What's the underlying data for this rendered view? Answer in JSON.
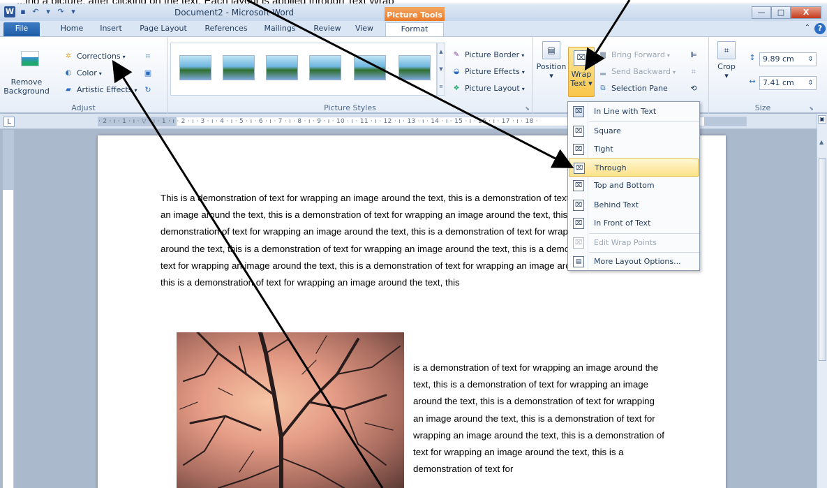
{
  "caption_top": "...ing a picture, after clicking on the text. Each layout is applied through Text Wrap",
  "title_bar": {
    "app_icon_letter": "W",
    "doc_title": "Document2 - Microsoft Word",
    "context_tab": "Picture Tools",
    "minimize": "—",
    "maximize": "□",
    "close": "X"
  },
  "tabs": [
    "File",
    "Home",
    "Insert",
    "Page Layout",
    "References",
    "Mailings",
    "Review",
    "View",
    "Format"
  ],
  "active_tab": "Format",
  "ribbon": {
    "adjust": {
      "remove_background": "Remove Background",
      "corrections": "Corrections",
      "color": "Color",
      "artistic_effects": "Artistic Effects",
      "label": "Adjust"
    },
    "picture_styles": {
      "border": "Picture Border",
      "effects": "Picture Effects",
      "layout": "Picture Layout",
      "label": "Picture Styles"
    },
    "arrange": {
      "position": "Position",
      "wrap_text_line1": "Wrap",
      "wrap_text_line2": "Text",
      "bring_forward": "Bring Forward",
      "send_backward": "Send Backward",
      "selection_pane": "Selection Pane"
    },
    "size": {
      "crop": "Crop",
      "height": "9.89 cm",
      "width": "7.41 cm",
      "label": "Size"
    }
  },
  "ruler_top_text": "· 2 · ı · 1 · ı · ▽ · ı · 1 · ı · 2 · ı · 3 · ı · 4 · ı · 5 · ı · 6 · ı · 7 · ı · 8 · ı · 9 · ı · 10 · ı · 11 · ı · 12 · ı · 13 · ı · 14 · ı · 15 · ı · 16 · ı · 17 · ı · 18 ·",
  "ruler_tab_selector": "L",
  "wrap_menu": {
    "items": [
      {
        "label": "In Line with Text",
        "mnemonic": "I"
      },
      {
        "label": "Square",
        "mnemonic": "S"
      },
      {
        "label": "Tight",
        "mnemonic": "T"
      },
      {
        "label": "Through",
        "mnemonic": "h"
      },
      {
        "label": "Top and Bottom",
        "mnemonic": "o"
      },
      {
        "label": "Behind Text",
        "mnemonic": "d"
      },
      {
        "label": "In Front of Text",
        "mnemonic": "n"
      },
      {
        "label": "Edit Wrap Points",
        "mnemonic": "E"
      },
      {
        "label": "More Layout Options...",
        "mnemonic": "L"
      }
    ],
    "highlighted": "Through"
  },
  "document": {
    "paragraph1": "This is a demonstration of text for wrapping an image around the text, this is a demonstration of text for wrapping an image around the text, this is a demonstration of text for wrapping an image around the text, this is a demonstration of text for wrapping an image around the text, this is a demonstration of text for wrapping an image around the text, this is a demonstration of text for wrapping an image around the text, this is a demonstration of text for wrapping an image around the text, this is a demonstration of text for wrapping an image around the text, this is a demonstration of text for wrapping an image around the text, this",
    "paragraph2": "is a demonstration of text for wrapping an image around the text, this is a demonstration of text for wrapping an image around the text, this is a demonstration of text for wrapping an image around the text, this is a demonstration of text for wrapping an image around the text, this is a demonstration of text for wrapping an image around the text, this is a demonstration of text for"
  }
}
